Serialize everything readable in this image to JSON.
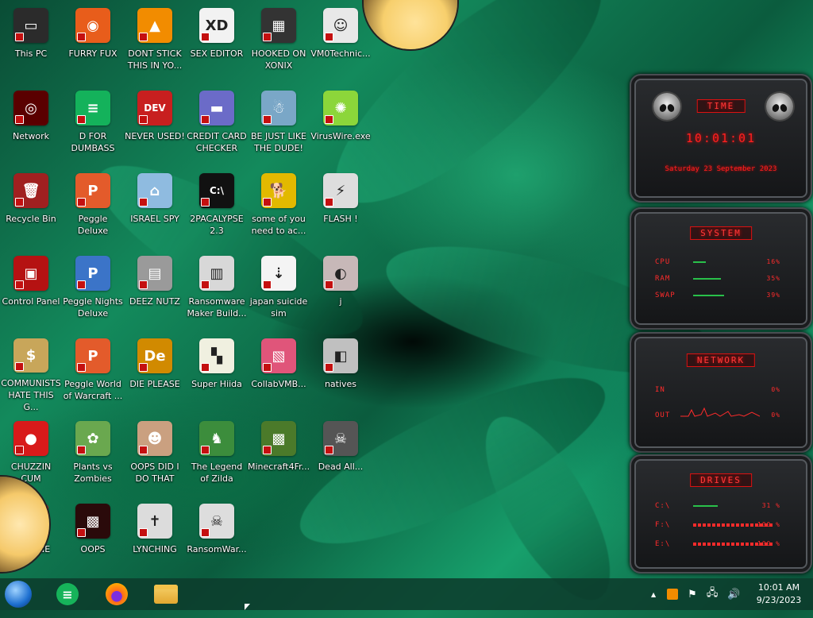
{
  "desktop": {
    "icons": [
      {
        "label": "This PC",
        "color": "#2b2b2b",
        "glyph": "▭"
      },
      {
        "label": "FURRY FUX",
        "color": "#e85d1b",
        "glyph": "◉"
      },
      {
        "label": "DONT STICK THIS IN YO...",
        "color": "#f28c00",
        "glyph": "▲"
      },
      {
        "label": "SEX EDITOR",
        "color": "#f2f2f2",
        "glyph": "XD"
      },
      {
        "label": "HOOKED ON XONIX",
        "color": "#333333",
        "glyph": "▦"
      },
      {
        "label": "VM0Technic...",
        "color": "#e8e8e8",
        "glyph": "☺"
      },
      {
        "label": "Network",
        "color": "#5a0000",
        "glyph": "◎"
      },
      {
        "label": "D FOR DUMBASS",
        "color": "#14b25b",
        "glyph": "≡"
      },
      {
        "label": "NEVER USED!",
        "color": "#c81f1f",
        "glyph": "DEV"
      },
      {
        "label": "CREDIT CARD CHECKER",
        "color": "#6b6bc8",
        "glyph": "▬"
      },
      {
        "label": "BE JUST LIKE THE DUDE!",
        "color": "#7aa7c7",
        "glyph": "☃"
      },
      {
        "label": "VirusWire.exe",
        "color": "#8cd63a",
        "glyph": "✺"
      },
      {
        "label": "Recycle Bin",
        "color": "#a02020",
        "glyph": "🗑"
      },
      {
        "label": "Peggle Deluxe",
        "color": "#e35b2b",
        "glyph": "P"
      },
      {
        "label": "ISRAEL SPY",
        "color": "#8fbbe0",
        "glyph": "⌂"
      },
      {
        "label": "2PACALYPSE 2.3",
        "color": "#111111",
        "glyph": "C:\\"
      },
      {
        "label": "some of you need to ac...",
        "color": "#e2b900",
        "glyph": "🐕"
      },
      {
        "label": "FLASH !",
        "color": "#dddddd",
        "glyph": "⚡"
      },
      {
        "label": "Control Panel",
        "color": "#b51212",
        "glyph": "▣"
      },
      {
        "label": "Peggle Nights Deluxe",
        "color": "#3b74c8",
        "glyph": "P"
      },
      {
        "label": "DEEZ NUTZ",
        "color": "#9a9a9a",
        "glyph": "▤"
      },
      {
        "label": "Ransomware Maker Build...",
        "color": "#d8d8d8",
        "glyph": "▥"
      },
      {
        "label": "japan suicide sim",
        "color": "#f4f4f4",
        "glyph": "⇣"
      },
      {
        "label": "j",
        "color": "#c7b8b8",
        "glyph": "◐"
      },
      {
        "label": "COMMUNISTS HATE THIS G...",
        "color": "#c8a65a",
        "glyph": "$"
      },
      {
        "label": "Peggle World of Warcraft ...",
        "color": "#e35b2b",
        "glyph": "P"
      },
      {
        "label": "DIE PLEASE",
        "color": "#d18a00",
        "glyph": "De"
      },
      {
        "label": "Super Hiida",
        "color": "#f0f0e0",
        "glyph": "▚"
      },
      {
        "label": "CollabVMB...",
        "color": "#e0557a",
        "glyph": "▧"
      },
      {
        "label": "natives",
        "color": "#c0c0c0",
        "glyph": "◧"
      },
      {
        "label": "CHUZZIN CUM",
        "color": "#d81a1a",
        "glyph": "●"
      },
      {
        "label": "Plants vs Zombies",
        "color": "#6aa84f",
        "glyph": "✿"
      },
      {
        "label": "OOPS DID I DO THAT",
        "color": "#caa080",
        "glyph": "☻"
      },
      {
        "label": "The Legend of Zilda",
        "color": "#3c8d3c",
        "glyph": "♞"
      },
      {
        "label": "Minecraft4Fr...",
        "color": "#4b7a2a",
        "glyph": "▩"
      },
      {
        "label": "Dead All...",
        "color": "#555555",
        "glyph": "☠"
      },
      {
        "label": "UKRAINE",
        "color": "#d81a1a",
        "glyph": "☢"
      },
      {
        "label": "OOPS",
        "color": "#2a0a0a",
        "glyph": "▩"
      },
      {
        "label": "LYNCHING",
        "color": "#dcdcdc",
        "glyph": "✝"
      },
      {
        "label": "RansomWar...",
        "color": "#dddddd",
        "glyph": "☠"
      }
    ]
  },
  "widget": {
    "time": {
      "title": "TIME",
      "clock": "10:01:01",
      "date": "Saturday 23 September 2023"
    },
    "system": {
      "title": "SYSTEM",
      "rows": [
        {
          "label": "CPU",
          "value": "16%",
          "fill": 0.16
        },
        {
          "label": "RAM",
          "value": "35%",
          "fill": 0.35
        },
        {
          "label": "SWAP",
          "value": "39%",
          "fill": 0.39
        }
      ]
    },
    "network": {
      "title": "NETWORK",
      "rows": [
        {
          "label": "IN",
          "value": "0%"
        },
        {
          "label": "OUT",
          "value": "0%"
        }
      ]
    },
    "drives": {
      "title": "DRIVES",
      "rows": [
        {
          "label": "C:\\",
          "value": "31 %",
          "fill": 0.31
        },
        {
          "label": "F:\\",
          "value": "100 %",
          "fill": 1.0
        },
        {
          "label": "E:\\",
          "value": "100 %",
          "fill": 1.0
        }
      ]
    }
  },
  "taskbar": {
    "time": "10:01 AM",
    "date": "9/23/2023",
    "tray_up": "▲"
  },
  "colors": {
    "accent": "#ff2b2b",
    "taskbar": "#0c3c2c"
  }
}
